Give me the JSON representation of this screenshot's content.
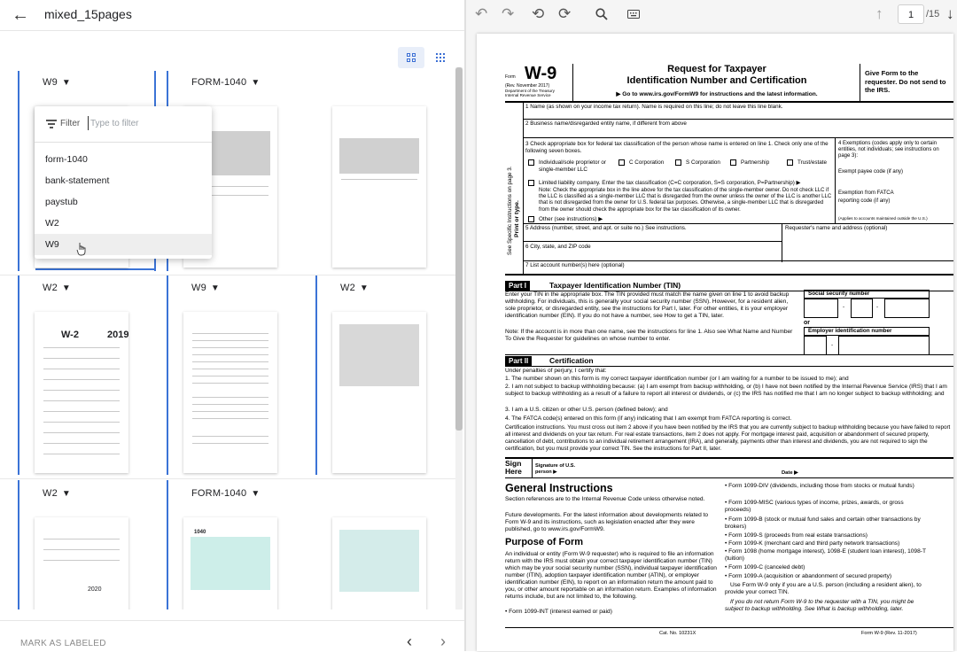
{
  "header": {
    "back_icon": "arrow-left-icon",
    "title": "mixed_15pages"
  },
  "view_toggle": {
    "large_icon": "grid-large-icon",
    "small_icon": "grid-small-icon"
  },
  "cells": [
    {
      "label": "W9"
    },
    {
      "label": "FORM-1040"
    },
    {
      "label": ""
    },
    {
      "label": "W2"
    },
    {
      "label": "W9"
    },
    {
      "label": "W2"
    },
    {
      "label": "W2"
    },
    {
      "label": "FORM-1040"
    },
    {
      "label": ""
    }
  ],
  "thumb_text": {
    "w2_title": "W-2",
    "w2_year": "2019",
    "w2b_year": "2020",
    "f1040": "1040"
  },
  "dropdown": {
    "filter_label": "Filter",
    "filter_placeholder": "Type to filter",
    "options": [
      "form-1040",
      "bank-statement",
      "paystub",
      "W2",
      "W9"
    ],
    "selected": "W9"
  },
  "footer": {
    "mark_label": "MARK AS LABELED",
    "prev": "‹",
    "next": "›"
  },
  "toolbar": {
    "icons": [
      "undo-icon",
      "redo-icon",
      "rotate-left-icon",
      "rotate-right-icon",
      "search-icon",
      "keyboard-icon",
      "arrow-up-icon",
      "arrow-down-icon"
    ],
    "page": "1",
    "total": "/15"
  },
  "doc": {
    "form_small": "Form",
    "form_name": "W-9",
    "rev": "(Rev. November 2017)",
    "dept1": "Department of the Treasury",
    "dept2": "Internal Revenue Service",
    "title1": "Request for Taxpayer",
    "title2": "Identification Number and Certification",
    "goto": "▶ Go to www.irs.gov/FormW9 for instructions and the latest information.",
    "give": "Give Form to the requester. Do not send to the IRS.",
    "line1": "1  Name (as shown on your income tax return). Name is required on this line; do not leave this line blank.",
    "line2": "2  Business name/disregarded entity name, if different from above",
    "line3": "3  Check appropriate box for federal tax classification of the person whose name is entered on line 1. Check only one of the following seven boxes.",
    "cb1": "Individual/sole proprietor or single-member LLC",
    "cb2": "C Corporation",
    "cb3": "S Corporation",
    "cb4": "Partnership",
    "cb5": "Trust/estate",
    "llc": "Limited liability company. Enter the tax classification (C=C corporation, S=S corporation, P=Partnership) ▶",
    "note": "Note: Check the appropriate box in the line above for the tax classification of the single-member owner.  Do not check LLC if the LLC is classified as a single-member LLC that is disregarded from the owner unless the owner of the LLC is another LLC that is not disregarded from the owner for U.S. federal tax purposes. Otherwise, a single-member LLC that is disregarded from the owner should check the appropriate box for the tax classification of its owner.",
    "other": "Other (see instructions) ▶",
    "ex4": "4  Exemptions (codes apply only to certain entities, not individuals; see instructions on page 3):",
    "exempt_payee": "Exempt payee code (if any)",
    "fatca": "Exemption from FATCA reporting code (if any)",
    "applies": "(Applies to accounts maintained outside the U.S.)",
    "line5": "5  Address (number, street, and apt. or suite no.) See instructions.",
    "requester": "Requester's name and address (optional)",
    "line6": "6  City, state, and ZIP code",
    "line7": "7  List account number(s) here (optional)",
    "side": "See Specific Instructions on page 3.",
    "side2": "Print or type.",
    "part1": "Part I",
    "part1_title": "Taxpayer Identification Number (TIN)",
    "tin_text": "Enter your TIN in the appropriate box. The TIN provided must match the name given on line 1 to avoid backup withholding. For individuals, this is generally your social security number (SSN). However, for a resident alien, sole proprietor, or disregarded entity, see the instructions for Part I, later. For other entities, it is your employer identification number (EIN). If you do not have a number, see How to get a TIN, later.",
    "tin_note": "Note: If the account is in more than one name, see the instructions for line 1. Also see What Name and Number To Give the Requester for guidelines on whose number to enter.",
    "ssn": "Social security number",
    "or": "or",
    "ein": "Employer identification number",
    "part2": "Part II",
    "part2_title": "Certification",
    "under": "Under penalties of perjury, I certify that:",
    "c1": "1. The number shown on this form is my correct taxpayer identification number (or I am waiting for a number to be issued to me); and",
    "c2": "2. I am not subject to backup withholding because: (a) I am exempt from backup withholding, or (b) I have not been notified by the Internal Revenue Service (IRS) that I am subject to backup withholding as a result of a failure to report all interest or dividends, or (c) the IRS has notified me that I am no longer subject to backup withholding; and",
    "c3": "3. I am a U.S. citizen or other U.S. person (defined below); and",
    "c4": "4. The FATCA code(s) entered on this form (if any) indicating that I am exempt from FATCA reporting is correct.",
    "cert_instr": "Certification instructions. You must cross out item 2 above if you have been notified by the IRS that you are currently subject to backup withholding because you have failed to report all interest and dividends on your tax return. For real estate transactions, item 2 does not apply. For mortgage interest paid, acquisition or abandonment of secured property, cancellation of debt, contributions to an individual retirement arrangement (IRA), and generally, payments other than interest and dividends, you are not required to sign the certification, but you must provide your correct TIN. See the instructions for Part II, later.",
    "sign": "Sign Here",
    "sig_of": "Signature of U.S. person ▶",
    "date": "Date ▶",
    "gen": "General Instructions",
    "gen_text": "Section references are to the Internal Revenue Code unless otherwise noted.",
    "future": "Future developments. For the latest information about developments related to Form W-9 and its instructions, such as legislation enacted after they were published, go to www.irs.gov/FormW9.",
    "purpose": "Purpose of Form",
    "purpose_text": "An individual or entity (Form W-9 requester) who is required to file an information return with the IRS must obtain your correct taxpayer identification number (TIN) which may be your social security number (SSN), individual taxpayer identification number (ITIN), adoption taxpayer identification number (ATIN), or employer identification number (EIN), to report on an information return the amount paid to you, or other amount reportable on an information return. Examples of information returns include, but are not limited to, the following.",
    "b_int": "• Form 1099-INT (interest earned or paid)",
    "rb1": "• Form 1099-DIV (dividends, including those from stocks or mutual funds)",
    "rb2": "• Form 1099-MISC (various types of income, prizes, awards, or gross proceeds)",
    "rb3": "• Form 1099-B (stock or mutual fund sales and certain other transactions by brokers)",
    "rb4": "• Form 1099-S (proceeds from real estate transactions)",
    "rb5": "• Form 1099-K (merchant card and third party network transactions)",
    "rb6": "• Form 1098 (home mortgage interest), 1098-E (student loan interest), 1098-T (tuition)",
    "rb7": "• Form 1099-C (canceled debt)",
    "rb8": "• Form 1099-A (acquisition or abandonment of secured property)",
    "use": "Use Form W-9 only if you are a U.S. person (including a resident alien), to provide your correct TIN.",
    "ifnot": "If you do not return Form W-9 to the requester with a TIN, you might be subject to backup withholding. See What is backup withholding, later.",
    "cat": "Cat. No. 10231X",
    "foot_form": "Form W-9 (Rev. 11-2017)"
  }
}
